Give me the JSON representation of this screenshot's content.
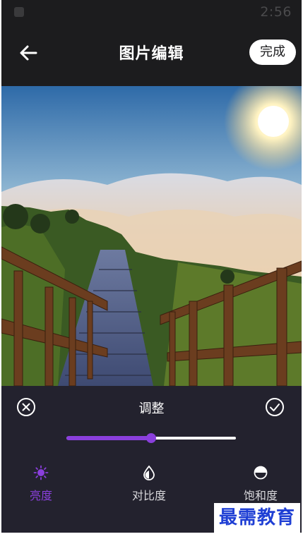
{
  "status_bar": {
    "time": "2:56"
  },
  "header": {
    "title": "图片编辑",
    "done_label": "完成",
    "back_icon": "arrow-left-icon"
  },
  "photo": {
    "subject": "wooden stairway above sea of clouds at sunrise"
  },
  "panel": {
    "title": "调整",
    "cancel_icon": "close-circle-icon",
    "confirm_icon": "check-circle-icon",
    "slider": {
      "value": 0.5,
      "fill_color": "#8a3fdc",
      "track_color": "#ffffff"
    },
    "tools": [
      {
        "label": "亮度",
        "icon": "brightness-icon",
        "active": true
      },
      {
        "label": "对比度",
        "icon": "contrast-icon",
        "active": false
      },
      {
        "label": "饱和度",
        "icon": "saturation-icon",
        "active": false
      }
    ]
  },
  "watermark": "最需教育",
  "colors": {
    "accent": "#8a3fdc",
    "background": "#1c1c1e",
    "panel": "#23222e"
  }
}
